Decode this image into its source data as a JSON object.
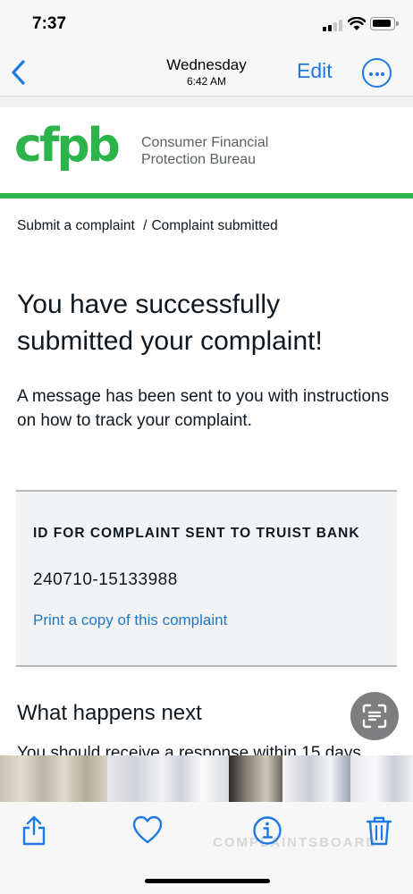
{
  "status_bar": {
    "time": "7:37"
  },
  "nav": {
    "title": "Wednesday",
    "subtitle": "6:42 AM",
    "edit_label": "Edit"
  },
  "org": {
    "logo_text": "cfpb",
    "name_line1": "Consumer Financial",
    "name_line2": "Protection Bureau"
  },
  "breadcrumb": {
    "item1": "Submit a complaint",
    "separator": "/",
    "item2": "Complaint submitted"
  },
  "content": {
    "headline": "You have successfully submitted your complaint!",
    "message": "A message has been sent to you with instructions on how to track your complaint.",
    "id_label": "ID FOR COMPLAINT SENT TO TRUIST BANK",
    "id_value": "240710-15133988",
    "print_link": "Print a copy of this complaint",
    "next_heading": "What happens next",
    "next_partial": "You should receive a response within 15 days"
  },
  "watermark": "COMPLAINTSBOARD",
  "colors": {
    "accent": "#1f7ae0",
    "cfpb_green": "#2cb34a",
    "link": "#1f77c5",
    "panel": "#f1f3f5"
  },
  "icons": [
    "back-chevron-icon",
    "more-icon",
    "live-text-icon",
    "share-icon",
    "heart-icon",
    "info-icon",
    "trash-icon"
  ]
}
